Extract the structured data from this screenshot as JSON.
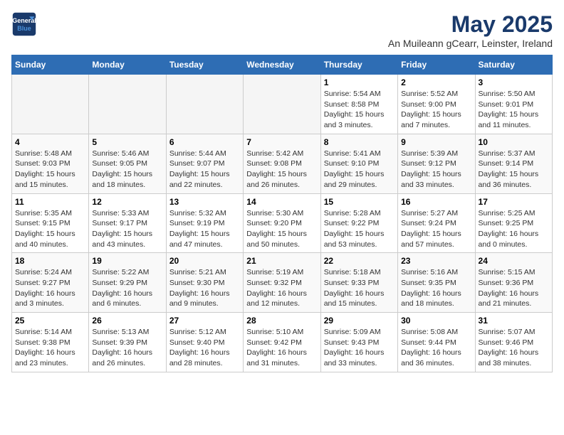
{
  "header": {
    "logo_line1": "General",
    "logo_line2": "Blue",
    "title": "May 2025",
    "subtitle": "An Muileann gCearr, Leinster, Ireland"
  },
  "days_of_week": [
    "Sunday",
    "Monday",
    "Tuesday",
    "Wednesday",
    "Thursday",
    "Friday",
    "Saturday"
  ],
  "weeks": [
    [
      {
        "day": "",
        "info": ""
      },
      {
        "day": "",
        "info": ""
      },
      {
        "day": "",
        "info": ""
      },
      {
        "day": "",
        "info": ""
      },
      {
        "day": "1",
        "info": "Sunrise: 5:54 AM\nSunset: 8:58 PM\nDaylight: 15 hours\nand 3 minutes."
      },
      {
        "day": "2",
        "info": "Sunrise: 5:52 AM\nSunset: 9:00 PM\nDaylight: 15 hours\nand 7 minutes."
      },
      {
        "day": "3",
        "info": "Sunrise: 5:50 AM\nSunset: 9:01 PM\nDaylight: 15 hours\nand 11 minutes."
      }
    ],
    [
      {
        "day": "4",
        "info": "Sunrise: 5:48 AM\nSunset: 9:03 PM\nDaylight: 15 hours\nand 15 minutes."
      },
      {
        "day": "5",
        "info": "Sunrise: 5:46 AM\nSunset: 9:05 PM\nDaylight: 15 hours\nand 18 minutes."
      },
      {
        "day": "6",
        "info": "Sunrise: 5:44 AM\nSunset: 9:07 PM\nDaylight: 15 hours\nand 22 minutes."
      },
      {
        "day": "7",
        "info": "Sunrise: 5:42 AM\nSunset: 9:08 PM\nDaylight: 15 hours\nand 26 minutes."
      },
      {
        "day": "8",
        "info": "Sunrise: 5:41 AM\nSunset: 9:10 PM\nDaylight: 15 hours\nand 29 minutes."
      },
      {
        "day": "9",
        "info": "Sunrise: 5:39 AM\nSunset: 9:12 PM\nDaylight: 15 hours\nand 33 minutes."
      },
      {
        "day": "10",
        "info": "Sunrise: 5:37 AM\nSunset: 9:14 PM\nDaylight: 15 hours\nand 36 minutes."
      }
    ],
    [
      {
        "day": "11",
        "info": "Sunrise: 5:35 AM\nSunset: 9:15 PM\nDaylight: 15 hours\nand 40 minutes."
      },
      {
        "day": "12",
        "info": "Sunrise: 5:33 AM\nSunset: 9:17 PM\nDaylight: 15 hours\nand 43 minutes."
      },
      {
        "day": "13",
        "info": "Sunrise: 5:32 AM\nSunset: 9:19 PM\nDaylight: 15 hours\nand 47 minutes."
      },
      {
        "day": "14",
        "info": "Sunrise: 5:30 AM\nSunset: 9:20 PM\nDaylight: 15 hours\nand 50 minutes."
      },
      {
        "day": "15",
        "info": "Sunrise: 5:28 AM\nSunset: 9:22 PM\nDaylight: 15 hours\nand 53 minutes."
      },
      {
        "day": "16",
        "info": "Sunrise: 5:27 AM\nSunset: 9:24 PM\nDaylight: 15 hours\nand 57 minutes."
      },
      {
        "day": "17",
        "info": "Sunrise: 5:25 AM\nSunset: 9:25 PM\nDaylight: 16 hours\nand 0 minutes."
      }
    ],
    [
      {
        "day": "18",
        "info": "Sunrise: 5:24 AM\nSunset: 9:27 PM\nDaylight: 16 hours\nand 3 minutes."
      },
      {
        "day": "19",
        "info": "Sunrise: 5:22 AM\nSunset: 9:29 PM\nDaylight: 16 hours\nand 6 minutes."
      },
      {
        "day": "20",
        "info": "Sunrise: 5:21 AM\nSunset: 9:30 PM\nDaylight: 16 hours\nand 9 minutes."
      },
      {
        "day": "21",
        "info": "Sunrise: 5:19 AM\nSunset: 9:32 PM\nDaylight: 16 hours\nand 12 minutes."
      },
      {
        "day": "22",
        "info": "Sunrise: 5:18 AM\nSunset: 9:33 PM\nDaylight: 16 hours\nand 15 minutes."
      },
      {
        "day": "23",
        "info": "Sunrise: 5:16 AM\nSunset: 9:35 PM\nDaylight: 16 hours\nand 18 minutes."
      },
      {
        "day": "24",
        "info": "Sunrise: 5:15 AM\nSunset: 9:36 PM\nDaylight: 16 hours\nand 21 minutes."
      }
    ],
    [
      {
        "day": "25",
        "info": "Sunrise: 5:14 AM\nSunset: 9:38 PM\nDaylight: 16 hours\nand 23 minutes."
      },
      {
        "day": "26",
        "info": "Sunrise: 5:13 AM\nSunset: 9:39 PM\nDaylight: 16 hours\nand 26 minutes."
      },
      {
        "day": "27",
        "info": "Sunrise: 5:12 AM\nSunset: 9:40 PM\nDaylight: 16 hours\nand 28 minutes."
      },
      {
        "day": "28",
        "info": "Sunrise: 5:10 AM\nSunset: 9:42 PM\nDaylight: 16 hours\nand 31 minutes."
      },
      {
        "day": "29",
        "info": "Sunrise: 5:09 AM\nSunset: 9:43 PM\nDaylight: 16 hours\nand 33 minutes."
      },
      {
        "day": "30",
        "info": "Sunrise: 5:08 AM\nSunset: 9:44 PM\nDaylight: 16 hours\nand 36 minutes."
      },
      {
        "day": "31",
        "info": "Sunrise: 5:07 AM\nSunset: 9:46 PM\nDaylight: 16 hours\nand 38 minutes."
      }
    ]
  ]
}
